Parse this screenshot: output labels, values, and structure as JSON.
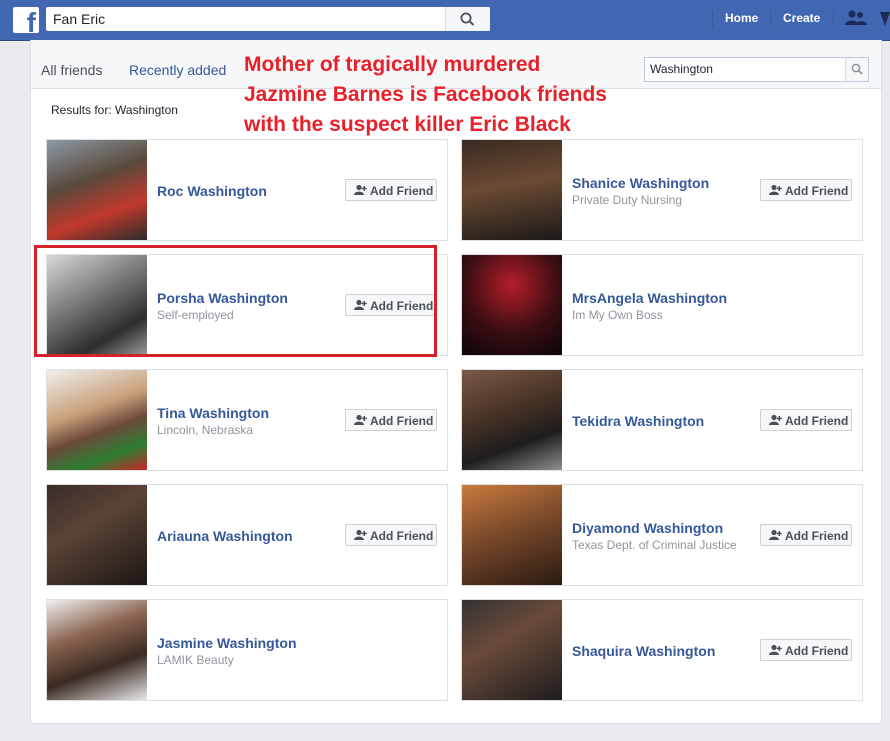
{
  "topbar": {
    "search_value": "Fan Eric",
    "nav": {
      "home": "Home",
      "create": "Create"
    },
    "icons": [
      "facebook-logo-icon",
      "search-icon",
      "friends-icon"
    ]
  },
  "tabs": {
    "all_friends": "All friends",
    "recently_added": "Recently added"
  },
  "filter": {
    "value": "Washington"
  },
  "results_text": "Results for: Washington",
  "annotation": "Mother of tragically murdered Jazmine Barnes is Facebook friends with the suspect killer Eric Black",
  "add_friend_label": "Add Friend",
  "colors": {
    "brand_blue": "#4267b2",
    "link_blue": "#365899",
    "annotation_red": "#e8202a",
    "highlight_red": "#d3222a"
  },
  "friends": [
    {
      "name": "Roc Washington",
      "sub": "",
      "add_friend": true
    },
    {
      "name": "Shanice Washington",
      "sub": "Private Duty Nursing",
      "add_friend": true
    },
    {
      "name": "Porsha Washington",
      "sub": "Self-employed",
      "add_friend": true,
      "highlighted": true
    },
    {
      "name": "MrsAngela Washington",
      "sub": "Im My Own Boss",
      "add_friend": false
    },
    {
      "name": "Tina Washington",
      "sub": "Lincoln, Nebraska",
      "add_friend": true
    },
    {
      "name": "Tekidra Washington",
      "sub": "",
      "add_friend": true
    },
    {
      "name": "Ariauna Washington",
      "sub": "",
      "add_friend": true
    },
    {
      "name": "Diyamond Washington",
      "sub": "Texas Dept. of Criminal Justice",
      "add_friend": true
    },
    {
      "name": "Jasmine Washington",
      "sub": "LAMIK Beauty",
      "add_friend": false
    },
    {
      "name": "Shaquira Washington",
      "sub": "",
      "add_friend": true
    }
  ]
}
